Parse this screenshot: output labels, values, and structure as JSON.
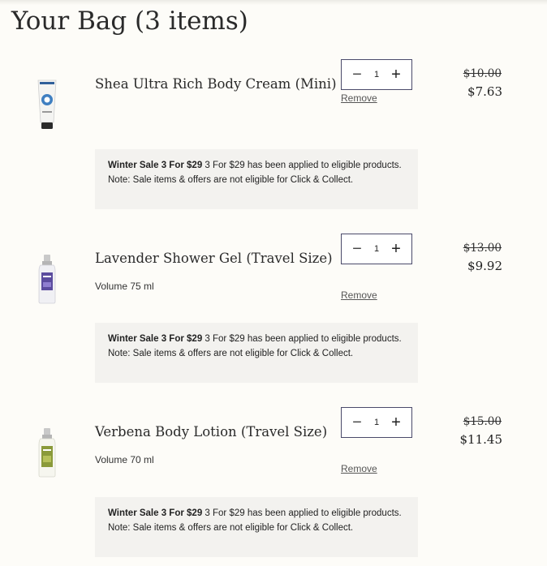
{
  "bag": {
    "title": "Your Bag (3 items)"
  },
  "items": [
    {
      "name": "Shea Ultra Rich Body Cream (Mini)",
      "volume": "",
      "quantity": "1",
      "remove_label": "Remove",
      "old_price": "$10.00",
      "new_price": "$7.63",
      "promo_bold": "Winter Sale 3 For $29",
      "promo_text": " 3 For $29 has been applied to eligible products. Note: Sale items & offers are not eligible for Click & Collect.",
      "icon": "shea-cream-tube-icon"
    },
    {
      "name": "Lavender Shower Gel (Travel Size)",
      "volume": "Volume 75 ml",
      "quantity": "1",
      "remove_label": "Remove",
      "old_price": "$13.00",
      "new_price": "$9.92",
      "promo_bold": "Winter Sale 3 For $29",
      "promo_text": " 3 For $29 has been applied to eligible products. Note: Sale items & offers are not eligible for Click & Collect.",
      "icon": "lavender-bottle-icon"
    },
    {
      "name": "Verbena Body Lotion (Travel Size)",
      "volume": "Volume 70 ml",
      "quantity": "1",
      "remove_label": "Remove",
      "old_price": "$15.00",
      "new_price": "$11.45",
      "promo_bold": "Winter Sale 3 For $29",
      "promo_text": " 3 For $29 has been applied to eligible products. Note: Sale items & offers are not eligible for Click & Collect.",
      "icon": "verbena-bottle-icon"
    }
  ],
  "controls": {
    "minus_symbol": "−",
    "plus_symbol": "+"
  },
  "colors": {
    "page_bg": "#fdfcf8",
    "promo_bg": "#f3f2ef",
    "qty_border": "#4a4a6a"
  }
}
